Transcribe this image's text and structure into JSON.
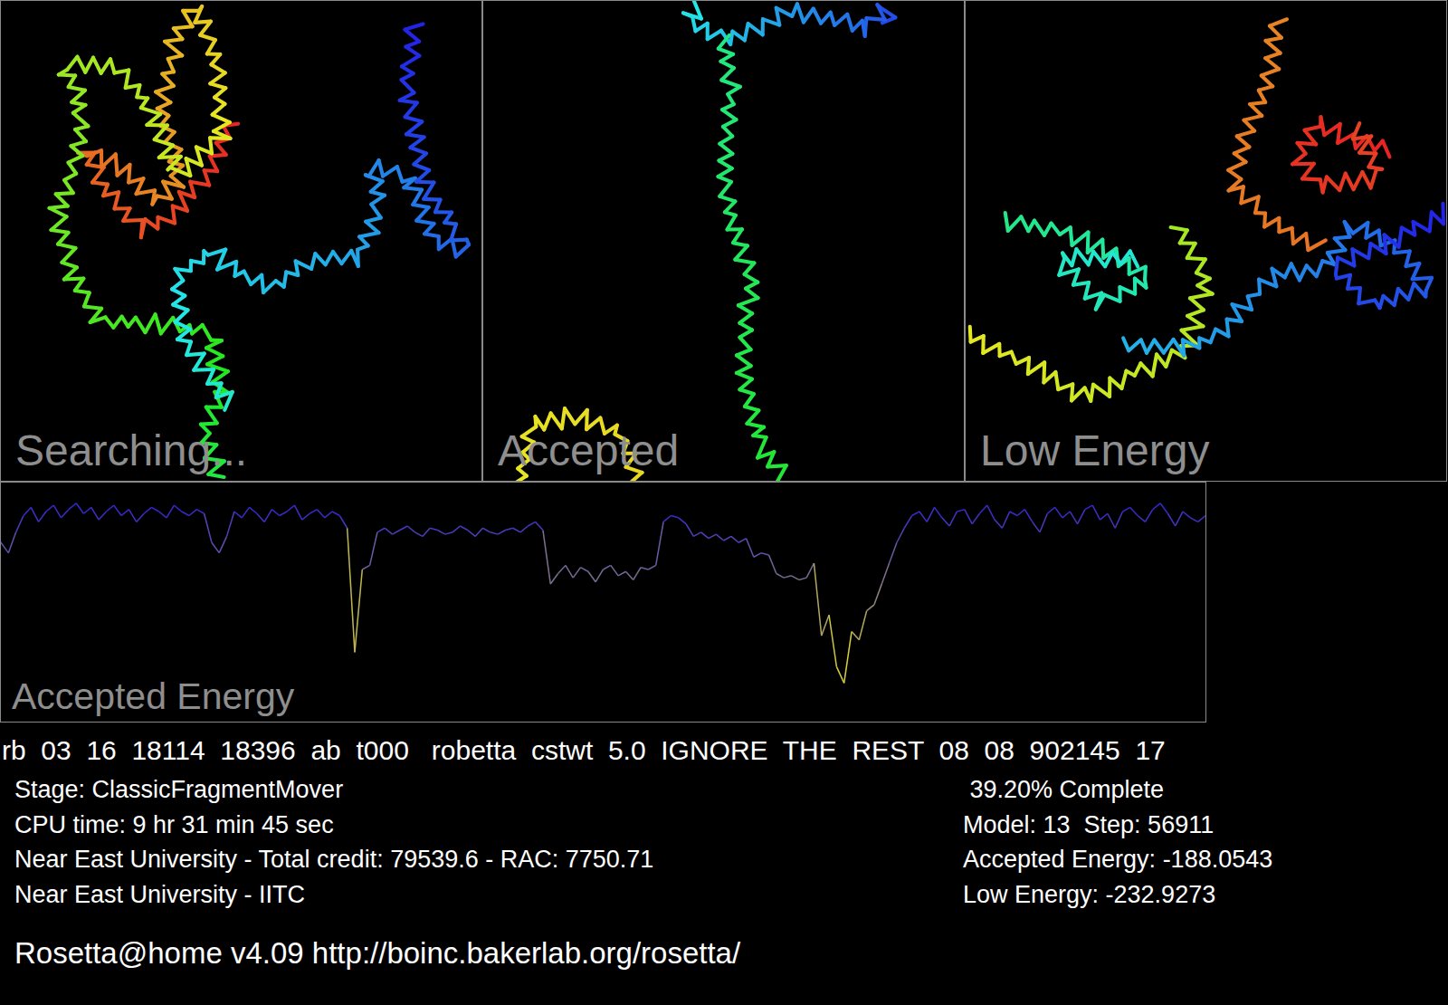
{
  "panels": [
    {
      "label": "Searching..."
    },
    {
      "label": "Accepted"
    },
    {
      "label": "Low Energy"
    }
  ],
  "energy_chart": {
    "label": "Accepted Energy",
    "values": [
      -165,
      -170,
      -160,
      -152,
      -148,
      -155,
      -150,
      -147,
      -153,
      -149,
      -146,
      -151,
      -148,
      -154,
      -150,
      -147,
      -152,
      -149,
      -155,
      -151,
      -148,
      -150,
      -153,
      -147,
      -150,
      -152,
      -149,
      -151,
      -165,
      -170,
      -162,
      -150,
      -153,
      -148,
      -151,
      -155,
      -149,
      -152,
      -150,
      -147,
      -154,
      -151,
      -149,
      -153,
      -150,
      -152,
      -158,
      -218,
      -178,
      -176,
      -160,
      -158,
      -161,
      -159,
      -157,
      -160,
      -162,
      -158,
      -159,
      -161,
      -160,
      -157,
      -159,
      -162,
      -158,
      -160,
      -161,
      -159,
      -158,
      -160,
      -157,
      -155,
      -159,
      -185,
      -180,
      -176,
      -182,
      -177,
      -179,
      -184,
      -178,
      -176,
      -181,
      -179,
      -183,
      -177,
      -178,
      -176,
      -155,
      -152,
      -153,
      -156,
      -162,
      -160,
      -163,
      -161,
      -164,
      -162,
      -165,
      -163,
      -172,
      -170,
      -171,
      -180,
      -182,
      -181,
      -183,
      -182,
      -175,
      -210,
      -200,
      -225,
      -232.9,
      -208,
      -212,
      -198,
      -195,
      -185,
      -175,
      -165,
      -158,
      -152,
      -150,
      -155,
      -148,
      -153,
      -157,
      -150,
      -149,
      -156,
      -151,
      -147,
      -154,
      -158,
      -150,
      -152,
      -149,
      -155,
      -160,
      -151,
      -148,
      -153,
      -150,
      -156,
      -149,
      -147,
      -154,
      -151,
      -158,
      -150,
      -148,
      -152,
      -155,
      -149,
      -146,
      -151,
      -157,
      -150,
      -153,
      -155,
      -152
    ]
  },
  "job_line": "rb  03  16  18114  18396  ab  t000   robetta  cstwt  5.0  IGNORE  THE  REST  08  08  902145  17",
  "status_left": [
    "Stage: ClassicFragmentMover",
    "CPU time: 9 hr 31 min 45 sec",
    "Near East University - Total credit: 79539.6 - RAC: 7750.71",
    "Near East University - IITC"
  ],
  "status_right": [
    " 39.20% Complete",
    "Model: 13  Step: 56911",
    "Accepted Energy: -188.0543",
    "Low Energy: -232.9273"
  ],
  "footer": "Rosetta@home v4.09 http://boinc.bakerlab.org/rosetta/"
}
